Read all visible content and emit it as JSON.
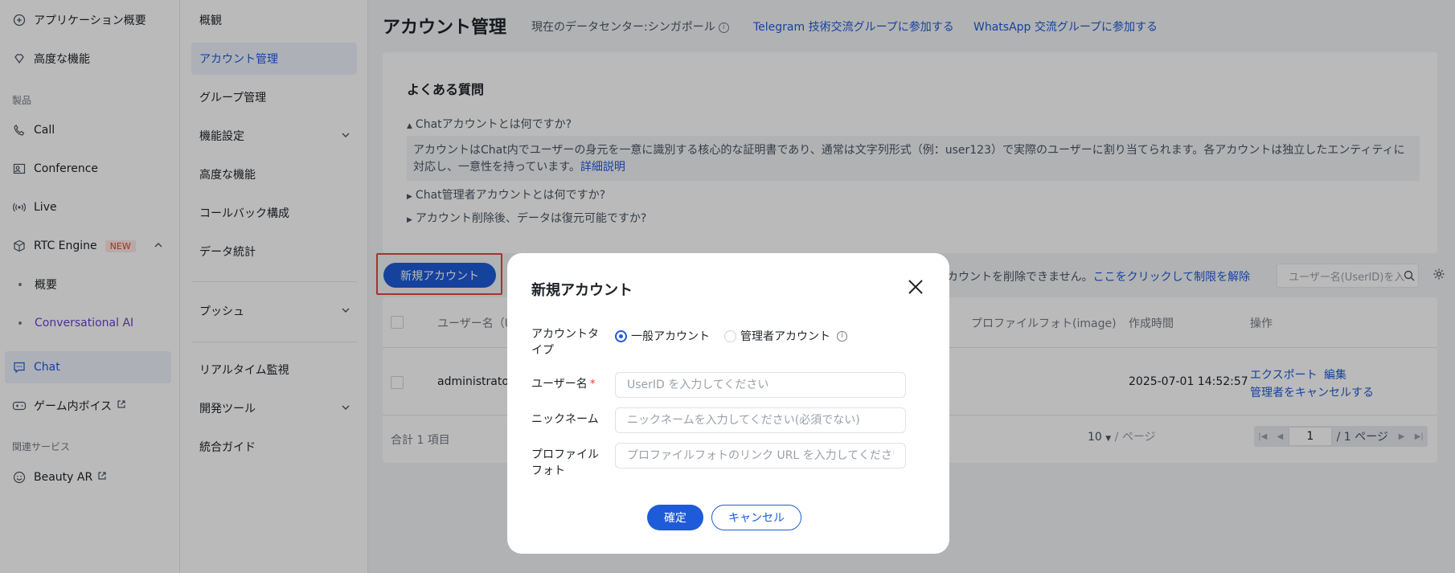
{
  "sidebar1": {
    "app_overview": "アプリケーション概要",
    "advanced": "高度な機能",
    "section_products": "製品",
    "call": "Call",
    "conference": "Conference",
    "live": "Live",
    "rtc_engine": "RTC Engine",
    "rtc_badge": "NEW",
    "rtc_sub_overview": "概要",
    "rtc_sub_conv_ai": "Conversational AI",
    "chat": "Chat",
    "game_voice": "ゲーム内ボイス",
    "section_related": "関連サービス",
    "beauty_ar": "Beauty AR"
  },
  "sidebar2": {
    "overview": "概観",
    "account_mgmt": "アカウント管理",
    "group_mgmt": "グループ管理",
    "feature_settings": "機能設定",
    "advanced": "高度な機能",
    "callback": "コールバック構成",
    "data_stats": "データ統計",
    "push": "プッシュ",
    "realtime_monitor": "リアルタイム監視",
    "dev_tools": "開発ツール",
    "integration_guide": "統合ガイド"
  },
  "header": {
    "title": "アカウント管理",
    "datacenter": "現在のデータセンター:シンガポール",
    "telegram_link": "Telegram 技術交流グループに参加する",
    "whatsapp_link": "WhatsApp 交流グループに参加する"
  },
  "faq": {
    "title": "よくある質問",
    "q1": "Chatアカウントとは何ですか?",
    "a1": "アカウントはChat内でユーザーの身元を一意に識別する核心的な証明書であり、通常は文字列形式（例：user123）で実際のユーザーに割り当てられます。各アカウントは独立したエンティティに対応し、一意性を持っています。",
    "a1_link": "詳細説明",
    "q2": "Chat管理者アカウントとは何ですか?",
    "q3": "アカウント削除後、データは復元可能ですか?"
  },
  "toolbar": {
    "new_account": "新規アカウント",
    "notice": "カウントを削除できません。",
    "notice_link": "ここをクリックして制限を解除",
    "search_placeholder": "ユーザー名(UserID)を入"
  },
  "table": {
    "headers": {
      "username": "ユーザー名（Use",
      "profile_photo": "プロファイルフォト(image)",
      "created": "作成時間",
      "ops": "操作"
    },
    "rows": [
      {
        "username": "administrator",
        "created": "2025-07-01 14:52:57",
        "op_export": "エクスポート",
        "op_edit": "編集",
        "op_cancel_admin": "管理者をキャンセルする"
      }
    ],
    "total": "合計 1 項目",
    "page_size": "10",
    "per_page": "/ ページ",
    "current_page": "1",
    "total_pages": "/ 1 ページ"
  },
  "modal": {
    "title": "新規アカウント",
    "label_account_type": "アカウントタイプ",
    "radio_general": "一般アカウント",
    "radio_admin": "管理者アカウント",
    "label_username": "ユーザー名",
    "username_placeholder": "UserID を入力してください",
    "label_nickname": "ニックネーム",
    "nickname_placeholder": "ニックネームを入力してください(必須でない)",
    "label_photo": "プロファイルフォト",
    "photo_placeholder": "プロファイルフォトのリンク URL を入力してください",
    "confirm": "確定",
    "cancel": "キャンセル"
  },
  "colors": {
    "primary": "#1e5bd8",
    "highlight": "#e54545",
    "badge": "#e0432a"
  }
}
